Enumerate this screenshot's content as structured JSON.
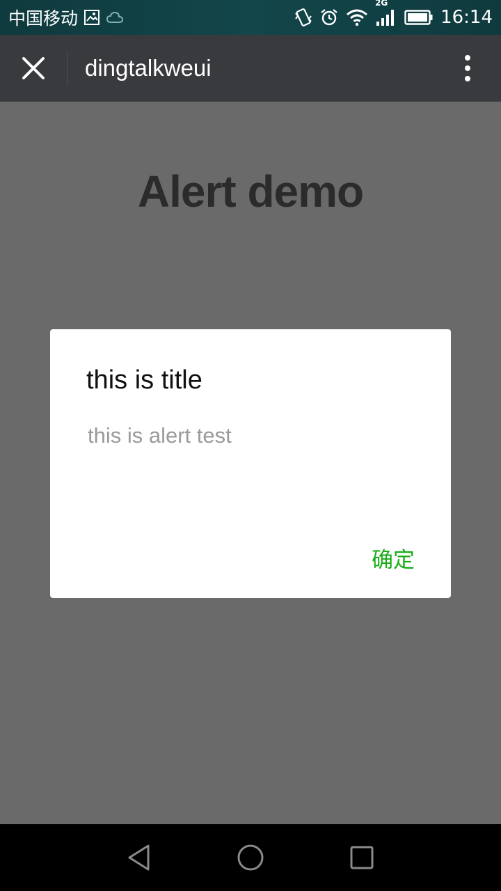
{
  "status_bar": {
    "carrier": "中国移动",
    "network": "2G",
    "time": "16:14",
    "icons": [
      "image-icon",
      "cloud-icon",
      "vibrate-icon",
      "alarm-icon",
      "wifi-icon",
      "signal-icon",
      "battery-icon"
    ]
  },
  "title_bar": {
    "title": "dingtalkweui",
    "icons": [
      "close-icon",
      "more-vertical-icon"
    ]
  },
  "page": {
    "heading": "Alert demo"
  },
  "dialog": {
    "title": "this is title",
    "message": "this is alert test",
    "confirm_label": "确定",
    "confirm_color": "#1aad19"
  },
  "nav_bar": {
    "icons": [
      "back-triangle-icon",
      "home-circle-icon",
      "recents-square-icon"
    ]
  },
  "colors": {
    "title_bar_bg": "#393a3e",
    "overlay_bg": "#6a6a6a",
    "dialog_bg": "#ffffff"
  }
}
